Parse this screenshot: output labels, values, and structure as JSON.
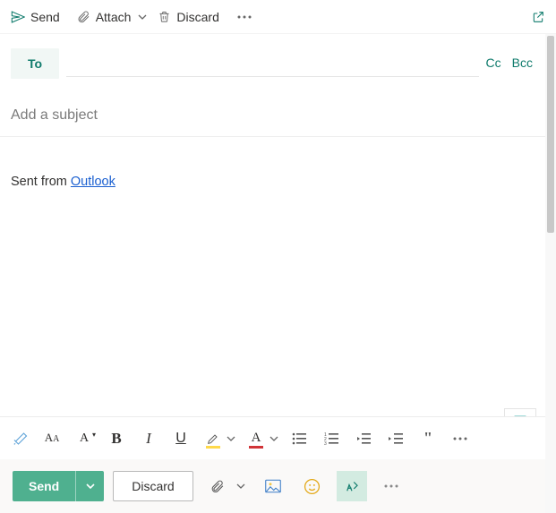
{
  "top": {
    "send": "Send",
    "attach": "Attach",
    "discard": "Discard"
  },
  "to": {
    "label": "To",
    "cc": "Cc",
    "bcc": "Bcc"
  },
  "subject": {
    "placeholder": "Add a subject"
  },
  "body": {
    "signature_prefix": "Sent from ",
    "signature_link_text": "Outlook"
  },
  "footer": {
    "send": "Send",
    "discard": "Discard"
  }
}
